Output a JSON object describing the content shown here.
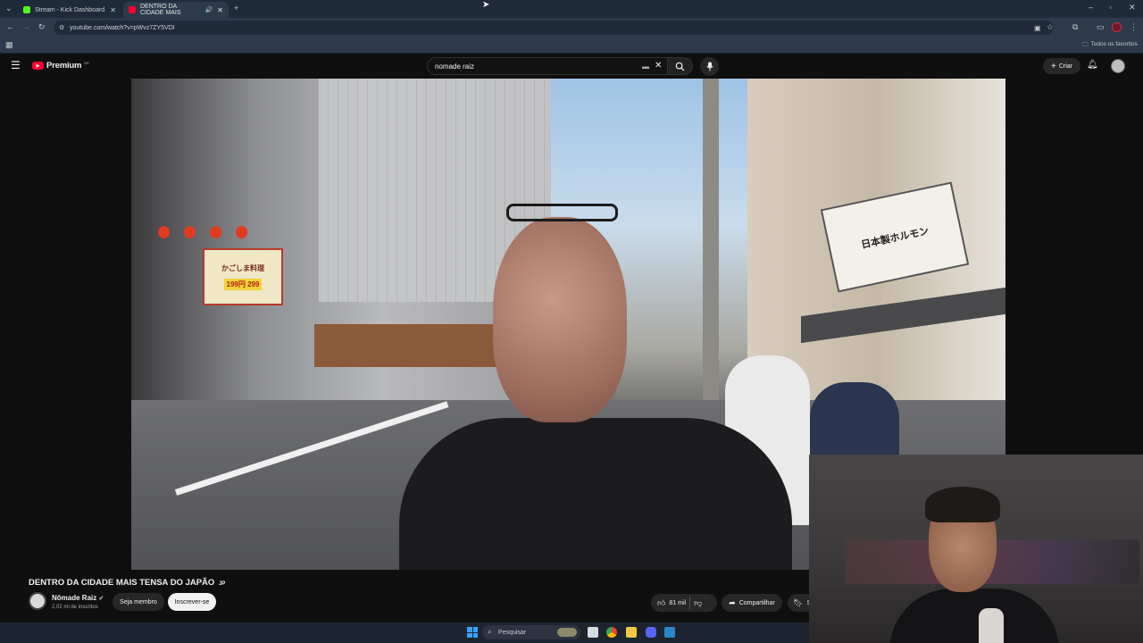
{
  "browser": {
    "tabs": [
      {
        "title": "Stream - Kick Dashboard",
        "active": false,
        "favicon_color": "#53fc18"
      },
      {
        "title": "DENTRO DA CIDADE MAIS",
        "active": true,
        "favicon_color": "#ff0033"
      }
    ],
    "url": "youtube.com/watch?v=pWvz7ZY5VDI",
    "bookmarks_label": "Todos os favoritos"
  },
  "youtube": {
    "logo_text": "Premium",
    "logo_superscript": "BR",
    "search_value": "nomade raiz",
    "create_label": "Criar"
  },
  "video": {
    "title": "DENTRO DA CIDADE MAIS TENSA DO JAPÃO",
    "title_flag": "JP",
    "channel": {
      "name": "Nômade Raiz",
      "subscribers": "2,02 mi de inscritos",
      "member_label": "Seja membro",
      "subscribe_label": "Inscrever-se"
    },
    "actions": {
      "likes": "81 mil",
      "share_label": "Compartilhar",
      "save_label": "S"
    },
    "signage": {
      "restaurant_sign": "かごしま料理",
      "price_text": "199円 299",
      "right_sign": "日本製ホルモン"
    }
  },
  "taskbar": {
    "search_placeholder": "Pesquisar"
  },
  "colors": {
    "youtube_red": "#ff0033",
    "background": "#0f0f0f",
    "chrome_tabbar": "#1f2b3a"
  }
}
